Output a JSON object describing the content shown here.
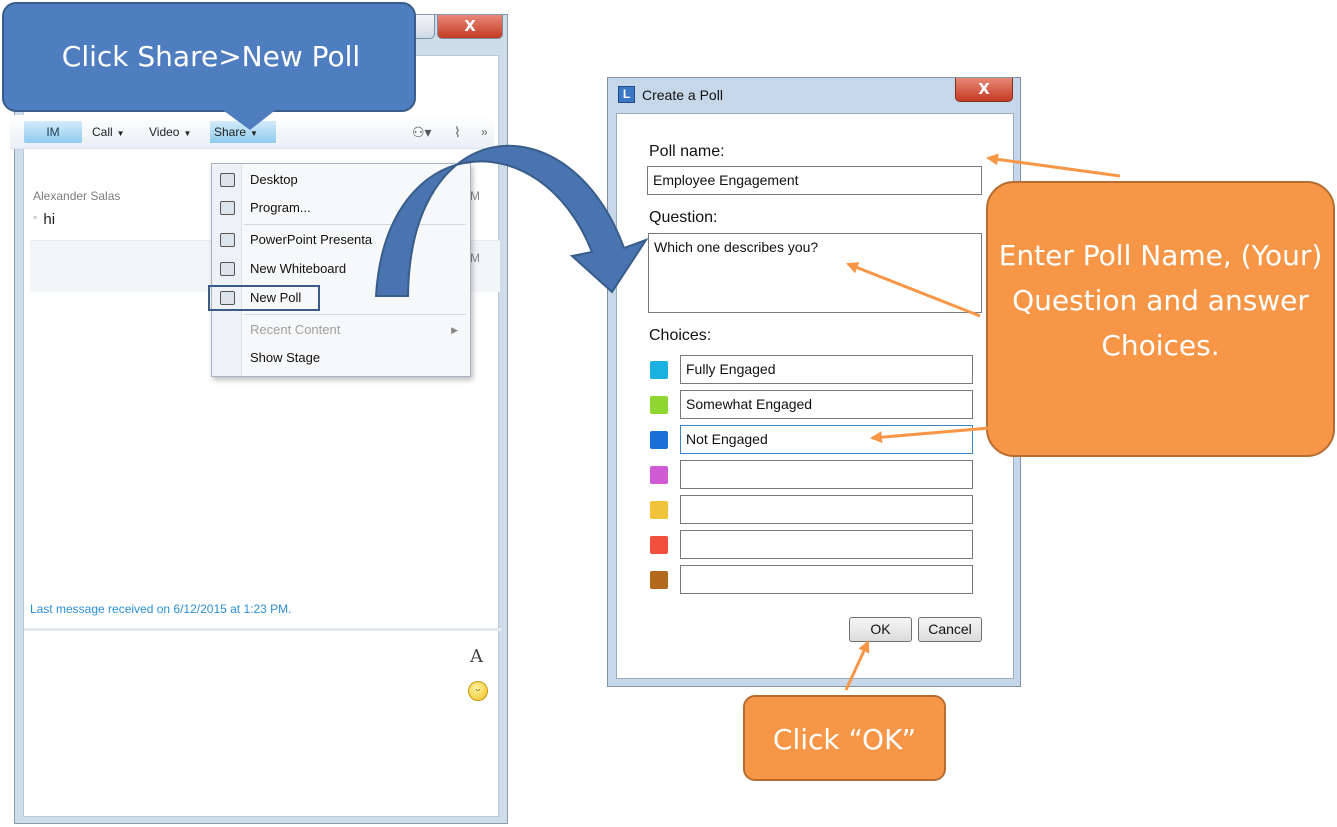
{
  "callouts": {
    "share_instruction": "Click Share>New Poll",
    "poll_instruction": "Enter Poll Name, (Your) Question and answer Choices.",
    "ok_instruction": "Click “OK”"
  },
  "lync": {
    "toolbar": {
      "im_label": "IM",
      "call_label": "Call",
      "video_label": "Video",
      "share_label": "Share",
      "more_label": "»"
    },
    "chat": {
      "sender": "Alexander Salas",
      "message": "hi",
      "timestamp_1": "M",
      "timestamp_2": "M",
      "status": "Last message received on 6/12/2015 at 1:23 PM."
    },
    "compose": {
      "font_label": "A"
    },
    "share_menu": [
      {
        "label": "Desktop",
        "icon": "monitor-icon",
        "disabled": false
      },
      {
        "label": "Program...",
        "icon": "program-icon",
        "disabled": false
      },
      {
        "label": "PowerPoint Presenta",
        "icon": "powerpoint-icon",
        "disabled": false
      },
      {
        "label": "New Whiteboard",
        "icon": "whiteboard-icon",
        "disabled": false
      },
      {
        "label": "New Poll",
        "icon": "poll-icon",
        "disabled": false
      },
      {
        "label": "Recent Content",
        "icon": "",
        "disabled": true
      },
      {
        "label": "Show Stage",
        "icon": "",
        "disabled": false
      }
    ]
  },
  "poll_dialog": {
    "title": "Create a Poll",
    "app_icon_letter": "L",
    "poll_name_label": "Poll name:",
    "poll_name_value": "Employee Engagement",
    "question_label": "Question:",
    "question_value": "Which one describes you?",
    "choices_label": "Choices:",
    "choices": [
      {
        "value": "Fully Engaged",
        "color": "#1ab0e0"
      },
      {
        "value": "Somewhat Engaged",
        "color": "#8fd630"
      },
      {
        "value": "Not Engaged",
        "color": "#1a6fd6"
      },
      {
        "value": "",
        "color": "#d05bd4"
      },
      {
        "value": "",
        "color": "#f0c33a"
      },
      {
        "value": "",
        "color": "#f0503c"
      },
      {
        "value": "",
        "color": "#b36a1c"
      }
    ],
    "ok_label": "OK",
    "cancel_label": "Cancel",
    "close_label": "X"
  },
  "colors": {
    "callout_blue": "#4f7ec0",
    "callout_orange": "#f79646",
    "arrow_orange": "#f79646",
    "curved_arrow_blue": "#4a74b0"
  }
}
